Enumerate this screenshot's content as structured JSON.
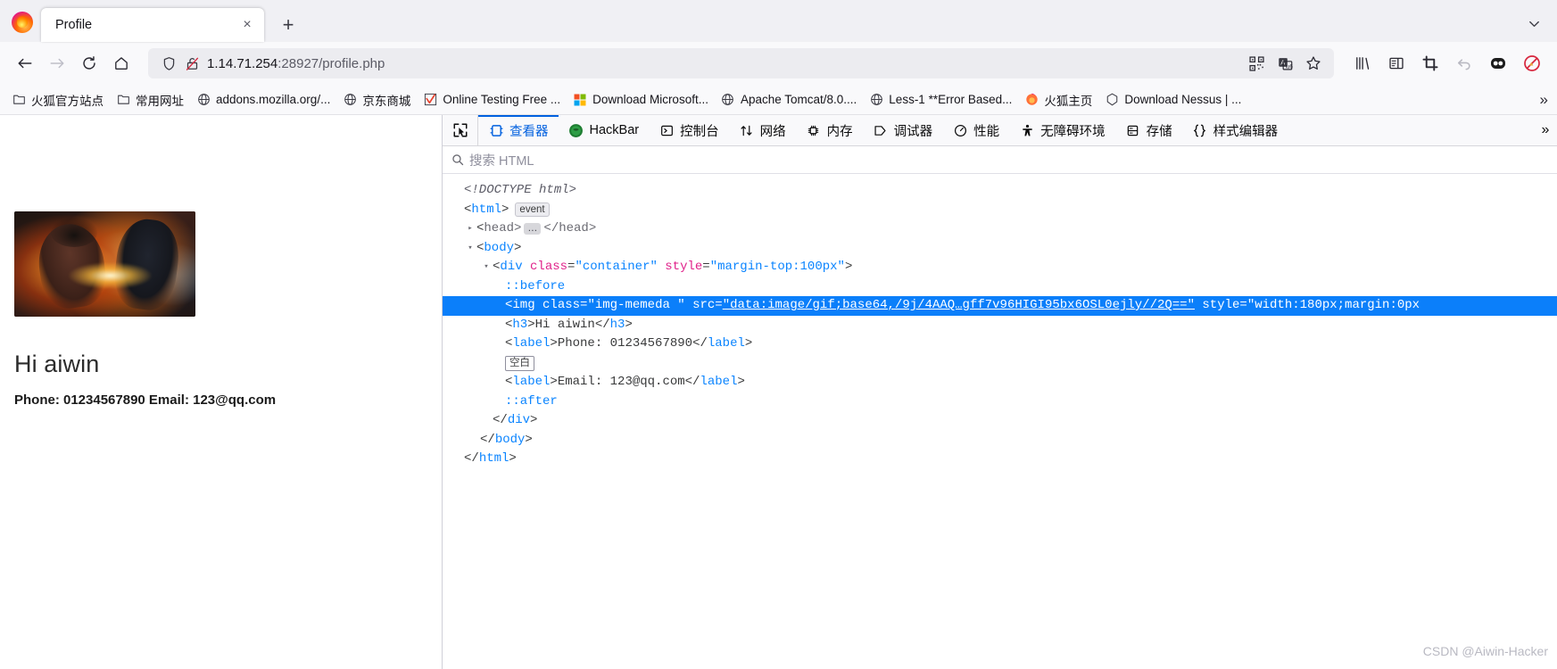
{
  "browser": {
    "tab": {
      "title": "Profile",
      "close_label": "×"
    },
    "newtab_label": "+",
    "tabstrip_menu_label": "⌄",
    "nav": {
      "back_label": "←",
      "forward_label": "→",
      "reload_label": "↻",
      "home_label": "⌂"
    },
    "url": {
      "host": "1.14.71.254",
      "rest": ":28927/profile.php",
      "full": "1.14.71.254:28927/profile.php"
    },
    "urlbar_icons": [
      "shield-icon",
      "lock-broken-icon",
      "qrcode-icon",
      "translate-icon",
      "bookmark-star-icon"
    ],
    "toolbar_icons": [
      "library-icon",
      "sidebar-icon",
      "screenshot-icon",
      "undo-icon",
      "dark-reader-icon",
      "blocker-icon"
    ]
  },
  "bookmarks": {
    "items": [
      {
        "icon": "folder-icon",
        "label": "火狐官方站点"
      },
      {
        "icon": "folder-icon",
        "label": "常用网址"
      },
      {
        "icon": "globe-icon",
        "label": "addons.mozilla.org/..."
      },
      {
        "icon": "globe-icon",
        "label": "京东商城"
      },
      {
        "icon": "checkmark-icon",
        "label": "Online Testing Free ..."
      },
      {
        "icon": "microsoft-icon",
        "label": "Download Microsoft..."
      },
      {
        "icon": "globe-icon",
        "label": "Apache Tomcat/8.0...."
      },
      {
        "icon": "globe-icon",
        "label": "Less-1 **Error Based..."
      },
      {
        "icon": "firefox-icon",
        "label": "火狐主页"
      },
      {
        "icon": "nessus-icon",
        "label": "Download Nessus | ..."
      }
    ],
    "overflow_label": "»"
  },
  "page": {
    "heading": "Hi aiwin",
    "meta": "Phone: 01234567890 Email: 123@qq.com",
    "image_alt": "profile-photo"
  },
  "devtools": {
    "picker_icon": "element-picker-icon",
    "tabs": [
      {
        "id": "inspector",
        "label": "查看器",
        "icon": "inspector-icon",
        "active": true
      },
      {
        "id": "hackbar",
        "label": "HackBar",
        "icon": "hackbar-icon",
        "active": false
      },
      {
        "id": "console",
        "label": "控制台",
        "icon": "console-icon",
        "active": false
      },
      {
        "id": "network",
        "label": "网络",
        "icon": "network-icon",
        "active": false
      },
      {
        "id": "memory",
        "label": "内存",
        "icon": "memory-icon",
        "active": false
      },
      {
        "id": "debugger",
        "label": "调试器",
        "icon": "debugger-icon",
        "active": false
      },
      {
        "id": "performance",
        "label": "性能",
        "icon": "performance-icon",
        "active": false
      },
      {
        "id": "accessibility",
        "label": "无障碍环境",
        "icon": "accessibility-icon",
        "active": false
      },
      {
        "id": "storage",
        "label": "存储",
        "icon": "storage-icon",
        "active": false
      },
      {
        "id": "style-editor",
        "label": "样式编辑器",
        "icon": "style-editor-icon",
        "active": false
      }
    ],
    "overflow_label": "»",
    "search": {
      "placeholder": "搜索 HTML",
      "value": ""
    },
    "markup": {
      "doctype": "<!DOCTYPE html>",
      "html_open_lt": "<",
      "html_tag": "html",
      "html_open_gt": ">",
      "event_badge": "event",
      "head_lt": "<",
      "head_tag": "head",
      "head_gt": ">",
      "head_ellipsis": "…",
      "head_close": "</head>",
      "body_lt": "<",
      "body_tag": "body",
      "body_gt": ">",
      "div_lt": "<",
      "div_tag": "div",
      "div_attr_class": "class",
      "div_val_class": "\"container\"",
      "div_attr_style": "style",
      "div_val_style": "\"margin-top:100px\"",
      "div_gt": ">",
      "before": "::before",
      "img_lt": "<",
      "img_tag": "img",
      "img_attr_class": "class",
      "img_val_class": "\"img-memeda \"",
      "img_attr_src": "src",
      "img_val_src": "\"data:image/gif;base64,/9j/4AAQ…gff7v96HIGI95bx6OSL0ejly//2Q==\"",
      "img_attr_style": "style",
      "img_val_style": "\"width:180px;margin:0px",
      "h3_open": "<h3>",
      "h3_text": "Hi aiwin",
      "h3_close": "</h3>",
      "label1_open": "<label>",
      "label1_text": "Phone: 01234567890",
      "label1_close": "</label>",
      "blank_badge": "空白",
      "label2_open": "<label>",
      "label2_text": "Email: 123@qq.com",
      "label2_close": "</label>",
      "after": "::after",
      "div_close": "</div>",
      "body_close": "</body>",
      "html_close": "</html>"
    }
  },
  "watermark": "CSDN @Aiwin-Hacker",
  "colors": {
    "accent": "#0060df",
    "selection": "#0b7ffa",
    "tag": "#0a84ff",
    "attr": "#e0218a",
    "chrome_bg": "#f9f9fb",
    "tabstrip_bg": "#f0f0f4"
  }
}
